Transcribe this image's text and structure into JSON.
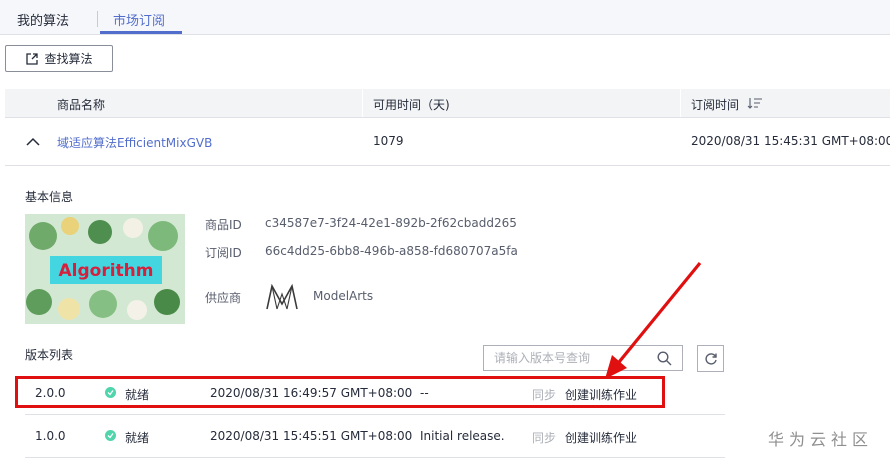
{
  "tabs": [
    {
      "label": "我的算法",
      "active": false
    },
    {
      "label": "市场订阅",
      "active": true
    }
  ],
  "toolbar": {
    "find_button": "查找算法",
    "find_icon": "external-link-icon"
  },
  "table": {
    "headers": {
      "name": "商品名称",
      "available_time": "可用时间（天)",
      "subscribe_time": "订阅时间"
    },
    "sort_icon": "sort-descending-icon",
    "row": {
      "name": "域适应算法EfficientMixGVB",
      "available_days": "1079",
      "subscribe_time": "2020/08/31 15:45:31 GMT+08:00",
      "expanded": true
    }
  },
  "detail": {
    "basic_info_title": "基本信息",
    "thumbnail_text": "Algorithm",
    "product_id_label": "商品ID",
    "product_id": "c34587e7-3f24-42e1-892b-2f62cbadd265",
    "subscription_id_label": "订阅ID",
    "subscription_id": "66c4dd25-6bb8-496b-a858-fd680707a5fa",
    "provider_label": "供应商",
    "provider_name": "ModelArts",
    "version_list_title": "版本列表",
    "search_placeholder": "请输入版本号查询",
    "versions": [
      {
        "version": "2.0.0",
        "status": "就绪",
        "time": "2020/08/31 16:49:57 GMT+08:00",
        "description": "--",
        "sync": "同步",
        "action": "创建训练作业"
      },
      {
        "version": "1.0.0",
        "status": "就绪",
        "time": "2020/08/31 15:45:51 GMT+08:00",
        "description": "Initial release.",
        "sync": "同步",
        "action": "创建训练作业"
      }
    ]
  },
  "watermark": "华为云社区",
  "colors": {
    "accent": "#526ecc",
    "highlight": "#e01010",
    "status_ok": "#50d4ab"
  }
}
